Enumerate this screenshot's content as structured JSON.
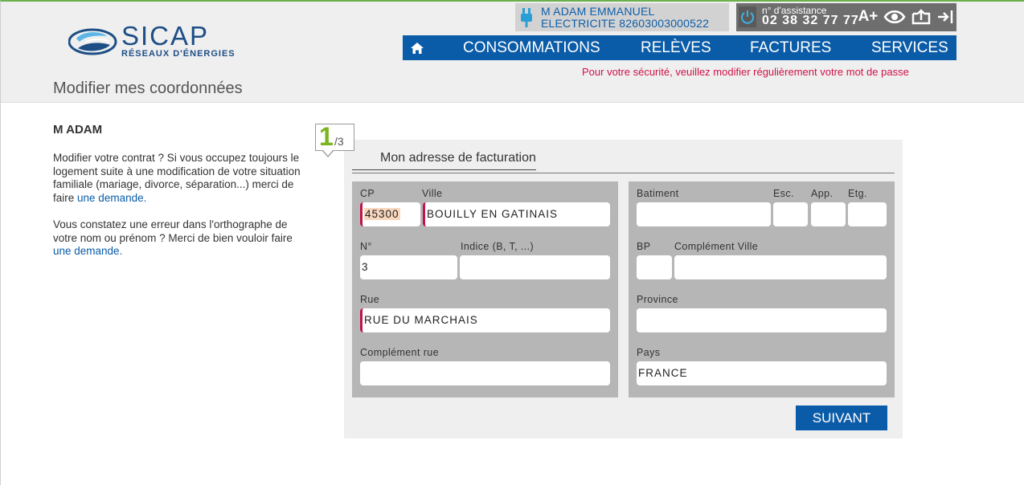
{
  "brand": {
    "name": "SICAP",
    "tagline": "RÉSEAUX D'ÉNERGIES"
  },
  "account": {
    "name": "M ADAM EMMANUEL",
    "contract": "ELECTRICITE 82603003000522"
  },
  "assistance": {
    "label": "n° d'assistance",
    "phone": "02 38 32 77 77"
  },
  "tools": {
    "font_increase": "A+"
  },
  "nav": {
    "items": [
      "CONSOMMATIONS",
      "RELÈVES",
      "FACTURES",
      "SERVICES"
    ]
  },
  "security_message": "Pour votre sécurité, veuillez modifier régulièrement votre mot de passe",
  "page_title": "Modifier mes coordonnées",
  "sidebar": {
    "name": "M ADAM",
    "p1_text": "Modifier votre contrat ? Si vous occupez toujours le logement suite à une modification de votre si­tuation familiale (mariage, divorce, séparation...) merci de faire",
    "p1_link": "une demande.",
    "p2_text": "Vous constatez une erreur dans l'orthographe de votre nom ou prénom ? Merci de bien vouloir faire",
    "p2_link": "une demande."
  },
  "step": {
    "current": "1",
    "total": "/3"
  },
  "form": {
    "title": "Mon adresse de facturation",
    "cp": {
      "label": "CP",
      "value": "45300"
    },
    "ville": {
      "label": "Ville",
      "value": "BOUILLY EN GATINAIS"
    },
    "numero": {
      "label": "N°",
      "value": "3"
    },
    "indice": {
      "label": "Indice (B, T, ...)",
      "value": ""
    },
    "rue": {
      "label": "Rue",
      "value": "RUE DU MARCHAIS"
    },
    "complement_rue": {
      "label": "Complément rue",
      "value": ""
    },
    "batiment": {
      "label": "Batiment",
      "value": ""
    },
    "esc": {
      "label": "Esc.",
      "value": ""
    },
    "app": {
      "label": "App.",
      "value": ""
    },
    "etg": {
      "label": "Etg.",
      "value": ""
    },
    "bp": {
      "label": "BP",
      "value": ""
    },
    "complement_ville": {
      "label": "Complément Ville",
      "value": ""
    },
    "province": {
      "label": "Province",
      "value": ""
    },
    "pays": {
      "label": "Pays",
      "value": "FRANCE"
    },
    "next_button": "SUIVANT"
  },
  "colors": {
    "nav_blue": "#0b5ca8",
    "alert_red": "#d0124a",
    "step_green": "#7ab51d",
    "panel_grey": "#b6b6b6"
  }
}
